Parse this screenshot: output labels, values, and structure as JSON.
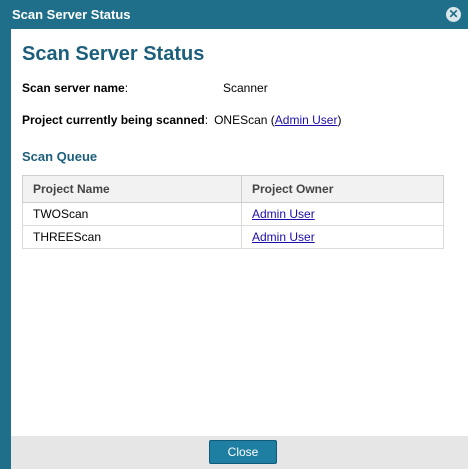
{
  "window": {
    "title": "Scan Server Status"
  },
  "main": {
    "heading": "Scan Server Status",
    "server_name_label": "Scan server name",
    "server_name_colon": ":",
    "server_name_value": "Scanner",
    "project_label": "Project currently being scanned",
    "project_colon": ":",
    "project_value": "ONEScan",
    "project_owner_open": "(",
    "project_owner_link": "Admin User",
    "project_owner_close": ")",
    "queue_title": "Scan Queue"
  },
  "queue": {
    "columns": [
      "Project Name",
      "Project Owner"
    ],
    "rows": [
      {
        "project": "TWOScan",
        "owner": "Admin User"
      },
      {
        "project": "THREEScan",
        "owner": "Admin User"
      }
    ]
  },
  "footer": {
    "close_label": "Close"
  },
  "colors": {
    "titlebar": "#1f6f8b",
    "heading": "#1c5f7c",
    "button": "#1f7fa3",
    "link": "#1a0dab"
  },
  "icons": {
    "close": "close-circle-icon"
  }
}
